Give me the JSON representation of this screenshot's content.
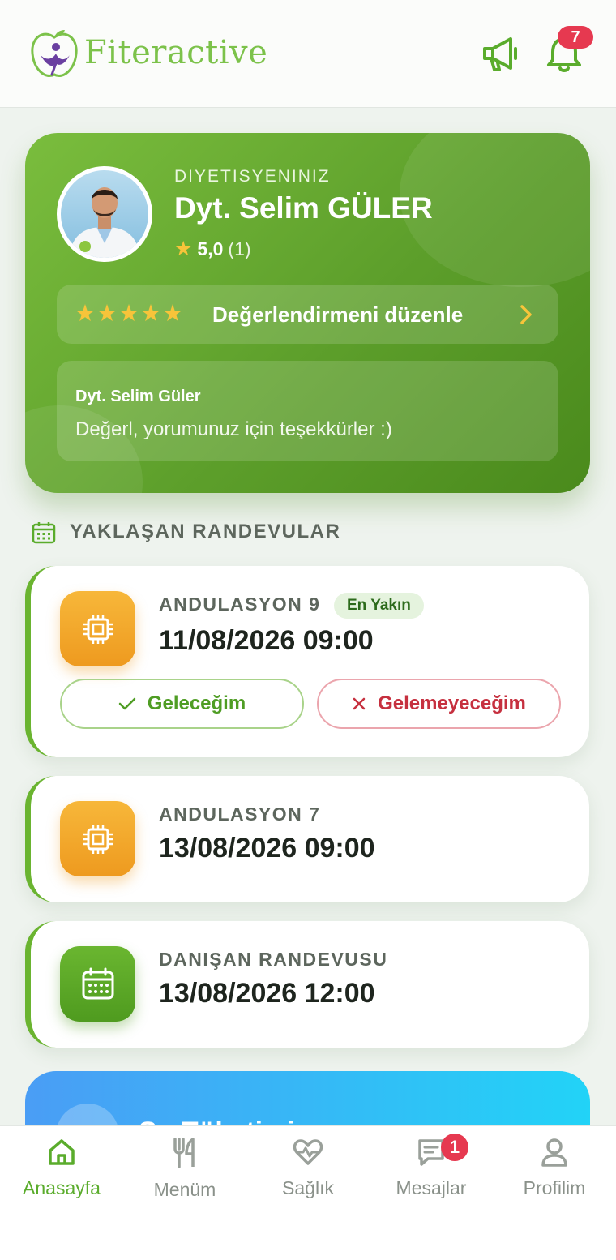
{
  "header": {
    "brand": "Fiteractive",
    "announcements_icon": "megaphone-icon",
    "notifications_icon": "bell-icon",
    "notification_count": "7"
  },
  "dietitian": {
    "label": "DIYETISYENINIZ",
    "name": "Dyt. Selim GÜLER",
    "rating_value": "5,0",
    "rating_count": "(1)",
    "review_stars": "★★★★★",
    "review_button": "Değerlendirmeni düzenle",
    "comment_author": "Dyt. Selim Güler",
    "comment_text": "Değerl, yorumunuz için teşekkürler :)"
  },
  "appointments": {
    "section_title": "YAKLAŞAN RANDEVULAR",
    "items": [
      {
        "name": "ANDULASYON 9",
        "date": "11/08/2026 09:00",
        "tag": "En Yakın",
        "icon": "chip-icon",
        "yes": "Geleceğim",
        "no": "Gelemeyeceğim"
      },
      {
        "name": "ANDULASYON 7",
        "date": "13/08/2026 09:00",
        "icon": "chip-icon"
      },
      {
        "name": "DANIŞAN RANDEVUSU",
        "date": "13/08/2026 12:00",
        "icon": "calendar-icon"
      }
    ]
  },
  "next_card": {
    "title": "Su Tüketimi"
  },
  "nav": {
    "items": [
      {
        "label": "Anasayfa",
        "icon": "home-icon",
        "active": true
      },
      {
        "label": "Menüm",
        "icon": "fork-knife-icon"
      },
      {
        "label": "Sağlık",
        "icon": "heart-pulse-icon"
      },
      {
        "label": "Mesajlar",
        "icon": "message-icon",
        "badge": "1"
      },
      {
        "label": "Profilim",
        "icon": "user-icon"
      }
    ]
  },
  "colors": {
    "primary": "#5aac2c",
    "accent_orange": "#f0a024",
    "danger": "#e63950"
  }
}
